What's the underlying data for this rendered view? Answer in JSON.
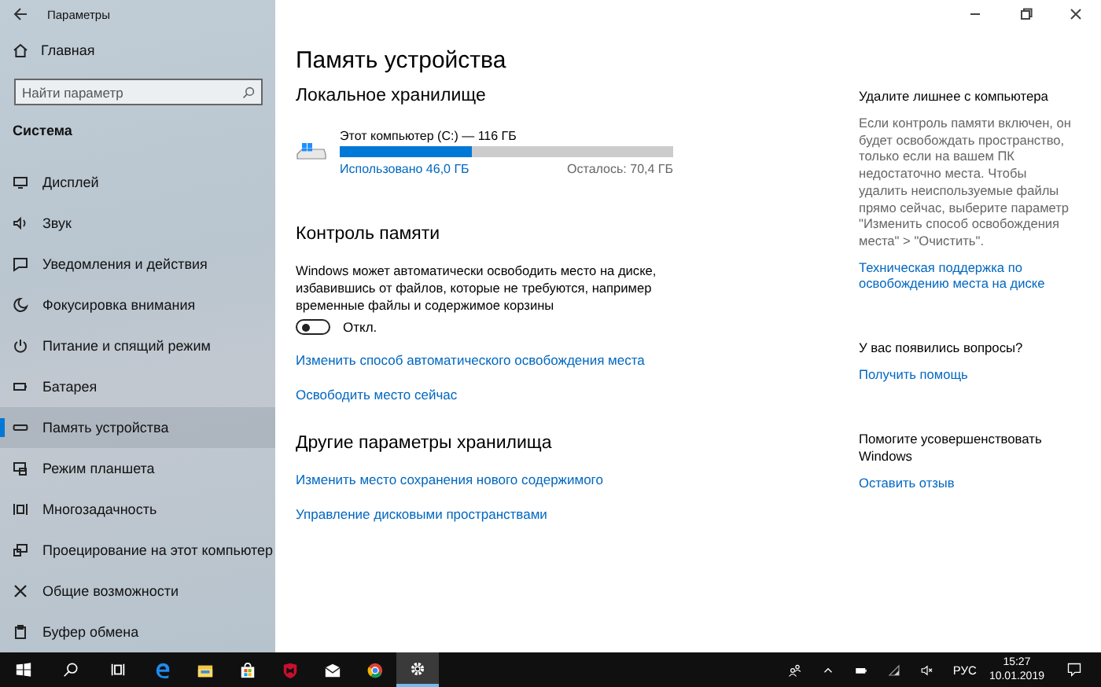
{
  "window": {
    "title": "Параметры"
  },
  "sidebar": {
    "home": "Главная",
    "search": {
      "placeholder": "Найти параметр"
    },
    "section": "Система",
    "items": [
      {
        "label": "Дисплей",
        "selected": false
      },
      {
        "label": "Звук",
        "selected": false
      },
      {
        "label": "Уведомления и действия",
        "selected": false
      },
      {
        "label": "Фокусировка внимания",
        "selected": false
      },
      {
        "label": "Питание и спящий режим",
        "selected": false
      },
      {
        "label": "Батарея",
        "selected": false
      },
      {
        "label": "Память устройства",
        "selected": true
      },
      {
        "label": "Режим планшета",
        "selected": false
      },
      {
        "label": "Многозадачность",
        "selected": false
      },
      {
        "label": "Проецирование на этот компьютер",
        "selected": false
      },
      {
        "label": "Общие возможности",
        "selected": false
      },
      {
        "label": "Буфер обмена",
        "selected": false
      }
    ]
  },
  "main": {
    "title": "Память устройства",
    "local_storage": {
      "heading": "Локальное хранилище",
      "drive": {
        "name": "Этот компьютер (C:) — 116 ГБ",
        "level": 0.397,
        "used": "Использовано 46,0 ГБ",
        "remaining": "Осталось: 70,4 ГБ"
      }
    },
    "storage_sense": {
      "heading": "Контроль памяти",
      "description": "Windows может автоматически освободить место на диске, избавившись от файлов, которые не требуются, например временные файлы и содержимое корзины",
      "toggle": {
        "on": false,
        "label": "Откл."
      },
      "links": [
        "Изменить способ автоматического освобождения места",
        "Освободить место сейчас"
      ]
    },
    "other": {
      "heading": "Другие параметры хранилища",
      "links": [
        "Изменить место сохранения нового содержимого",
        "Управление дисковыми пространствами"
      ]
    }
  },
  "aside": [
    {
      "heading": "Удалите лишнее с компьютера",
      "text": "Если контроль памяти включен, он будет освобождать пространство, только если на вашем ПК недостаточно места. Чтобы удалить неиспользуемые файлы прямо сейчас, выберите параметр \"Изменить способ освобождения места\" > \"Очистить\".",
      "link": "Техническая поддержка по освобождению места на диске"
    },
    {
      "heading": "У вас появились вопросы?",
      "link": "Получить помощь"
    },
    {
      "heading": "Помогите усовершенствовать Windows",
      "link": "Оставить отзыв"
    }
  ],
  "taskbar": {
    "apps": [
      {
        "selected": false
      },
      {
        "selected": false
      },
      {
        "selected": false
      },
      {
        "selected": false
      },
      {
        "selected": false
      },
      {
        "selected": false
      },
      {
        "selected": true
      }
    ],
    "language": "РУС",
    "time": "15:27",
    "date": "10.01.2019"
  }
}
